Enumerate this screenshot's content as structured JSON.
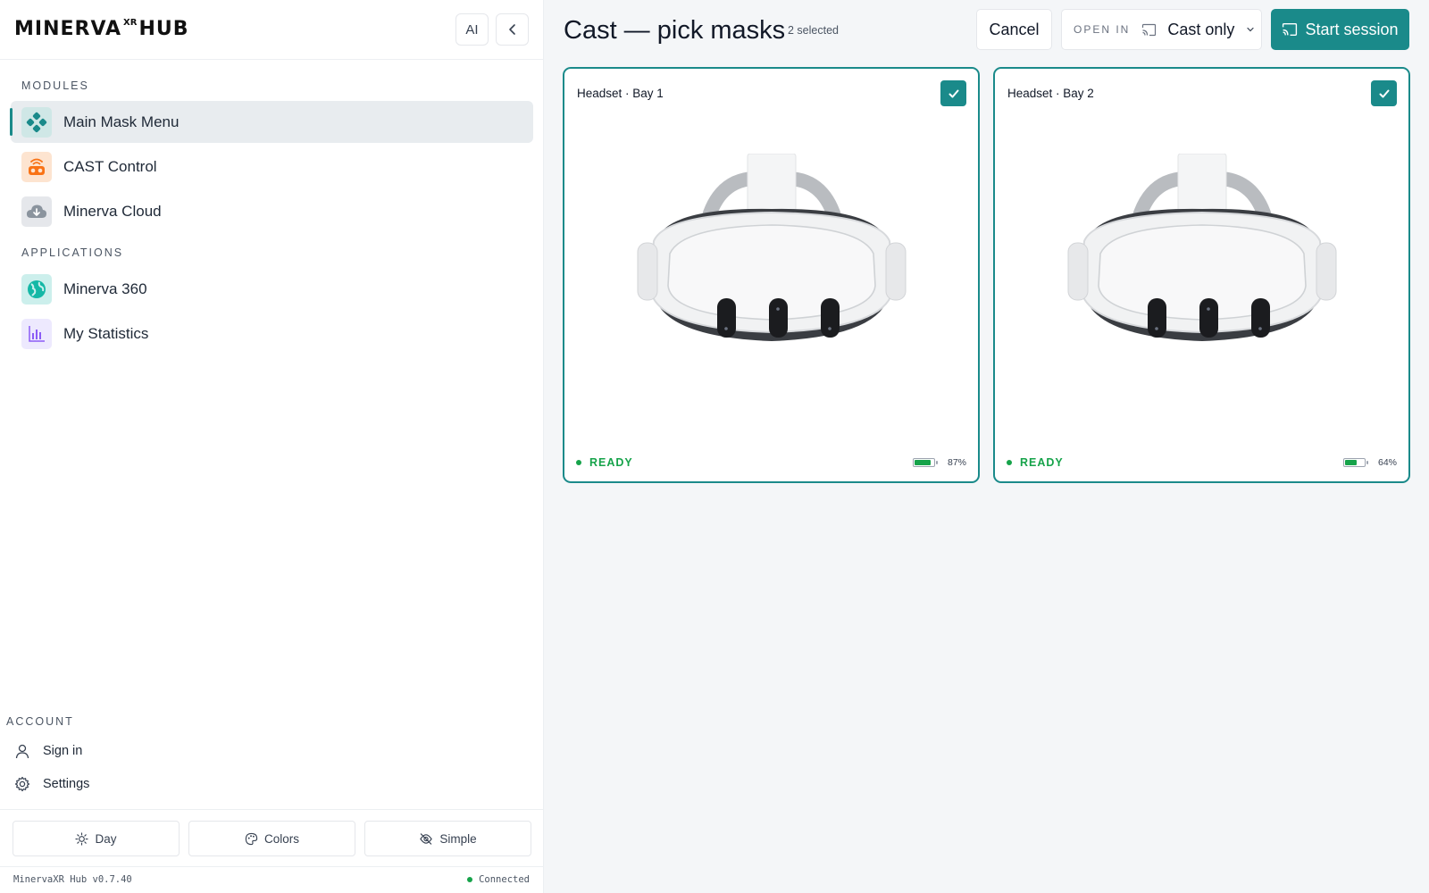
{
  "brand": {
    "name": "MINERVA",
    "sup": "XR",
    "suffix": "HUB"
  },
  "header_buttons": {
    "ai_label": "AI"
  },
  "sidebar": {
    "modules_label": "MODULES",
    "modules": [
      {
        "label": "Main Mask Menu",
        "icon": "main-mask-icon",
        "color": "#1a8a8a",
        "active": true
      },
      {
        "label": "CAST Control",
        "icon": "cast-control-icon",
        "color": "#f97316",
        "active": false
      },
      {
        "label": "Minerva Cloud",
        "icon": "cloud-icon",
        "color": "#6b7280",
        "active": false
      }
    ],
    "applications_label": "APPLICATIONS",
    "applications": [
      {
        "label": "Minerva 360",
        "icon": "globe-icon",
        "color": "#14b8a6"
      },
      {
        "label": "My Statistics",
        "icon": "bar-chart-icon",
        "color": "#8b5cf6"
      }
    ],
    "account_label": "ACCOUNT",
    "account": [
      {
        "label": "Sign in",
        "icon": "user-icon"
      },
      {
        "label": "Settings",
        "icon": "gear-icon"
      }
    ],
    "modes": [
      {
        "label": "Day",
        "icon": "sun-icon"
      },
      {
        "label": "Colors",
        "icon": "palette-icon"
      },
      {
        "label": "Simple",
        "icon": "eye-off-icon"
      }
    ],
    "version": "MinervaXR Hub v0.7.40",
    "connection": "Connected"
  },
  "main": {
    "title": "Cast — pick masks",
    "selected_count": "2 selected",
    "cancel_label": "Cancel",
    "open_in_label": "OPEN IN",
    "open_in_value": "Cast only",
    "start_label": "Start session",
    "accent": "#1a8a8a",
    "cards": [
      {
        "title": "Headset · Bay 1",
        "status": "READY",
        "battery_text": "87%",
        "battery": 0.87,
        "selected": true
      },
      {
        "title": "Headset · Bay 2",
        "status": "READY",
        "battery_text": "64%",
        "battery": 0.64,
        "selected": true
      }
    ]
  }
}
